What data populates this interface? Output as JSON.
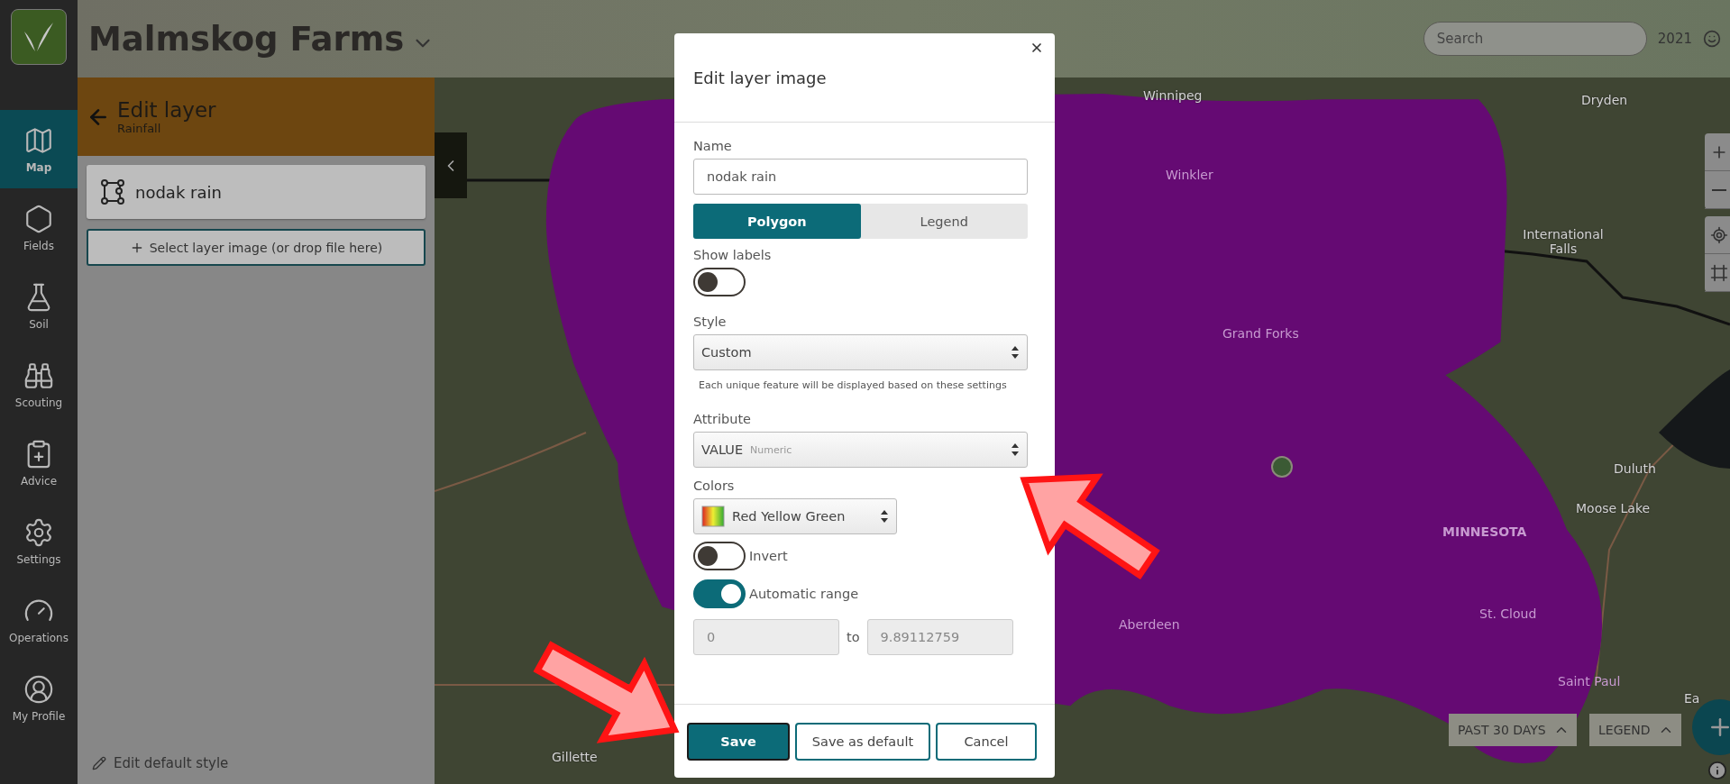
{
  "app": {
    "farm_name": "Malmskog Farms"
  },
  "nav": [
    {
      "label": "Map",
      "selected": true
    },
    {
      "label": "Fields",
      "selected": false
    },
    {
      "label": "Soil",
      "selected": false
    },
    {
      "label": "Scouting",
      "selected": false
    },
    {
      "label": "Advice",
      "selected": false
    },
    {
      "label": "Settings",
      "selected": false
    },
    {
      "label": "Operations",
      "selected": false
    },
    {
      "label": "My Profile",
      "selected": false
    }
  ],
  "header": {
    "search": {
      "placeholder": "Search"
    },
    "year": "2021"
  },
  "panel": {
    "title": "Edit layer",
    "subtitle": "Rainfall",
    "layers": [
      {
        "name": "nodak rain"
      }
    ],
    "select_button": "Select layer image (or drop file here)",
    "footer_link": "Edit default style"
  },
  "map": {
    "labels": [
      {
        "text": "Winnipeg",
        "faint": false
      },
      {
        "text": "Dryden",
        "faint": false
      },
      {
        "text": "Winkler",
        "faint": true
      },
      {
        "text": "International Falls",
        "faint": false
      },
      {
        "text": "Grand Forks",
        "faint": true
      },
      {
        "text": "Duluth",
        "faint": false
      },
      {
        "text": "Moose Lake",
        "faint": false
      },
      {
        "text": "MINNESOTA",
        "faint": true
      },
      {
        "text": "St. Cloud",
        "faint": true
      },
      {
        "text": "Aberdeen",
        "faint": true
      },
      {
        "text": "Saint Paul",
        "faint": true
      },
      {
        "text": "Gillette",
        "faint": false
      },
      {
        "text": "Ea",
        "faint": false
      }
    ],
    "buttons": [
      {
        "label": "PAST 30 DAYS"
      },
      {
        "label": "LEGEND"
      }
    ]
  },
  "dialog": {
    "title": "Edit layer image",
    "name": {
      "label": "Name",
      "value": "nodak rain"
    },
    "geometry_tabs": [
      {
        "label": "Polygon",
        "selected": true
      },
      {
        "label": "Legend",
        "selected": false
      }
    ],
    "show_labels": {
      "label": "Show labels",
      "on": false
    },
    "style": {
      "label": "Style",
      "value": "Custom",
      "help": "Each unique feature will be displayed based on these settings"
    },
    "attribute": {
      "label": "Attribute",
      "value": "VALUE",
      "type": "Numeric"
    },
    "colors": {
      "label": "Colors",
      "value": "Red Yellow Green"
    },
    "invert": {
      "label": "Invert",
      "on": false
    },
    "automatic_range": {
      "label": "Automatic range",
      "on": true
    },
    "range": {
      "min": "0",
      "separator": "to",
      "max": "9.89112759"
    },
    "buttons": [
      {
        "label": "Save",
        "kind": "primary"
      },
      {
        "label": "Save as default",
        "kind": "secondary"
      },
      {
        "label": "Cancel",
        "kind": "secondary"
      }
    ]
  }
}
